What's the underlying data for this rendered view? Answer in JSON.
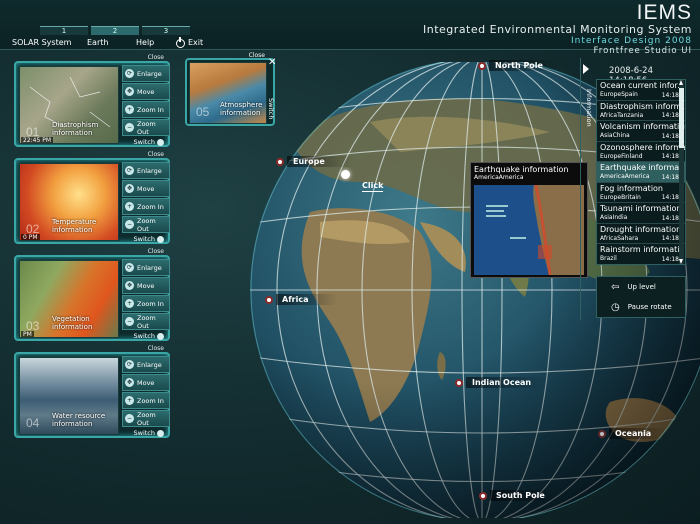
{
  "header": {
    "logo": "IEMS",
    "title": "Integrated Environmental Monitoring System",
    "subtitle": "Interface Design 2008",
    "studio": "Frontfree Studio UI",
    "tabs": [
      "1",
      "2",
      "3"
    ],
    "menu": [
      "SOLAR System",
      "Earth",
      "Help",
      "Exit"
    ]
  },
  "cards": [
    {
      "label": "Diastrophism information",
      "num": "01",
      "time": "22:45 PM"
    },
    {
      "label": "Temperature information",
      "num": "02",
      "time": "0 PM"
    },
    {
      "label": "Vegetation information",
      "num": "03",
      "time": "PM"
    },
    {
      "label": "Water resource information",
      "num": "04",
      "time": ""
    }
  ],
  "card_actions": {
    "enlarge": "Enlarge",
    "move": "Move",
    "zoom_in": "Zoom In",
    "zoom_out": "Zoom Out",
    "switch": "Switch",
    "close": "Close"
  },
  "atmosphere": {
    "num": "05",
    "label": "Atmosphere information",
    "switch": "Switch",
    "close": "Close"
  },
  "right_panel": {
    "datetime": "2008-6-24 14:18:56",
    "info_tab": "Information",
    "items": [
      {
        "title": "Ocean current infor..",
        "place": "EuropeSpain",
        "time": "14:18"
      },
      {
        "title": "Diastrophism inform..",
        "place": "AfricaTanzania",
        "time": "14:18"
      },
      {
        "title": "Volcanism information",
        "place": "AsiaChina",
        "time": "14:18"
      },
      {
        "title": "Ozonosphere informa..",
        "place": "EuropeFinland",
        "time": "14:18"
      },
      {
        "title": "Earthquake informat..",
        "place": "AmericaAmerica",
        "time": "14:18"
      },
      {
        "title": "Fog information",
        "place": "EuropeBritain",
        "time": "14:18"
      },
      {
        "title": "Tsunami information",
        "place": "AsiaIndia",
        "time": "14:18"
      },
      {
        "title": "Drought information",
        "place": "AfricaSahara",
        "time": "14:18"
      },
      {
        "title": "Rainstorm information",
        "place": "Brazil",
        "time": "14:18"
      }
    ],
    "up_level": "Up level",
    "pause_rotate": "Pause rotate"
  },
  "globe_labels": {
    "north_pole": "North Pole",
    "europe": "Europe",
    "africa": "Africa",
    "indian_ocean": "Indian Ocean",
    "oceania": "Oceania",
    "south_pole": "South Pole",
    "click": "Click"
  },
  "popup": {
    "title": "Earthquake information",
    "place": "AmericaAmerica"
  }
}
